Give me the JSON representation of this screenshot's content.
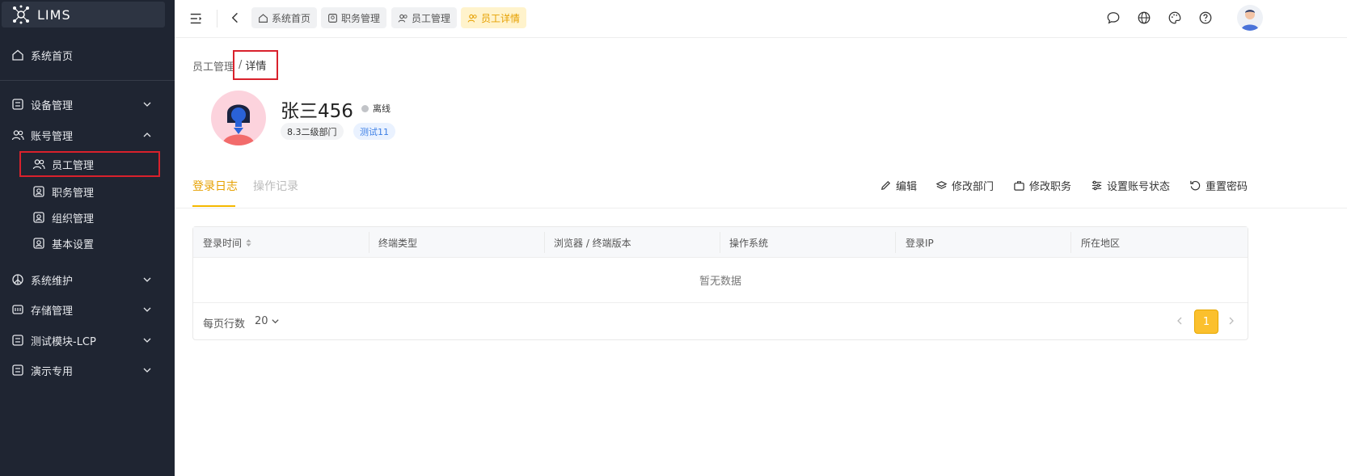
{
  "app": {
    "logo_text": "LIMS"
  },
  "sidebar": {
    "home": "系统首页",
    "groups": [
      {
        "label": "设备管理",
        "expanded": false
      },
      {
        "label": "账号管理",
        "expanded": true
      },
      {
        "label": "系统维护",
        "expanded": false
      },
      {
        "label": "存储管理",
        "expanded": false
      },
      {
        "label": "测试模块-LCP",
        "expanded": false
      },
      {
        "label": "演示专用",
        "expanded": false
      }
    ],
    "sub_items": [
      {
        "label": "员工管理",
        "active": true
      },
      {
        "label": "职务管理"
      },
      {
        "label": "组织管理"
      },
      {
        "label": "基本设置"
      }
    ]
  },
  "header": {
    "tabs": [
      {
        "label": "系统首页",
        "icon": "home-icon"
      },
      {
        "label": "职务管理",
        "icon": "badge-icon"
      },
      {
        "label": "员工管理",
        "icon": "users-icon"
      },
      {
        "label": "员工详情",
        "icon": "users-icon",
        "active": true
      }
    ],
    "right_icons": [
      "message-icon",
      "globe-icon",
      "palette-icon",
      "help-icon",
      "avatar"
    ]
  },
  "breadcrumb": {
    "parent": "员工管理",
    "separator": "/",
    "current": "详情"
  },
  "profile": {
    "name": "张三456",
    "status": "离线",
    "department": "8.3二级部门",
    "tag": "测试11"
  },
  "tabs": {
    "active": "登录日志",
    "inactive": "操作记录"
  },
  "actions": [
    "编辑",
    "修改部门",
    "修改职务",
    "设置账号状态",
    "重置密码"
  ],
  "table": {
    "columns": [
      "登录时间",
      "终端类型",
      "浏览器 / 终端版本",
      "操作系统",
      "登录IP",
      "所在地区"
    ],
    "empty_text": "暂无数据",
    "rows_label": "每页行数",
    "rows_per_page": "20",
    "current_page": "1"
  },
  "colors": {
    "accent": "#f5b800",
    "sidebar_bg": "#1f2532",
    "highlight_box": "#d9212c"
  }
}
